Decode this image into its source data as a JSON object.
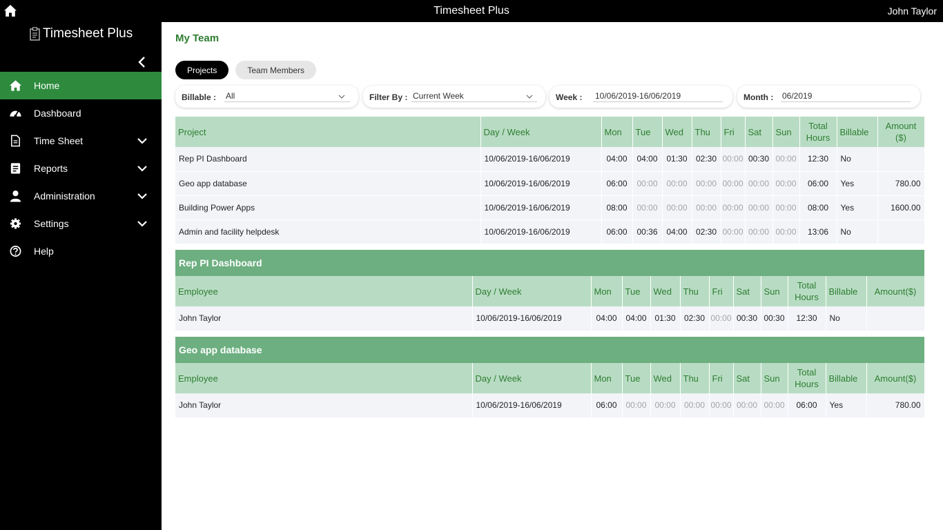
{
  "topbar": {
    "title": "Timesheet Plus",
    "user": "John Taylor"
  },
  "sidebar": {
    "brand": "Timesheet Plus",
    "items": [
      {
        "label": "Home",
        "icon": "home-icon",
        "active": true,
        "expandable": false
      },
      {
        "label": "Dashboard",
        "icon": "dashboard-gauge-icon",
        "active": false,
        "expandable": false
      },
      {
        "label": "Time Sheet",
        "icon": "document-icon",
        "active": false,
        "expandable": true
      },
      {
        "label": "Reports",
        "icon": "report-icon",
        "active": false,
        "expandable": true
      },
      {
        "label": "Administration",
        "icon": "user-icon",
        "active": false,
        "expandable": true
      },
      {
        "label": "Settings",
        "icon": "gear-icon",
        "active": false,
        "expandable": true
      },
      {
        "label": "Help",
        "icon": "help-icon",
        "active": false,
        "expandable": false
      }
    ]
  },
  "main": {
    "title": "My Team",
    "tabs": [
      {
        "label": "Projects",
        "selected": true
      },
      {
        "label": "Team Members",
        "selected": false
      }
    ],
    "filters": {
      "billable": {
        "label": "Billable :",
        "value": "All"
      },
      "filter_by": {
        "label": "Filter By :",
        "value": "Current Week"
      },
      "week": {
        "label": "Week :",
        "value": "10/06/2019-16/06/2019"
      },
      "month": {
        "label": "Month :",
        "value": "06/2019"
      }
    },
    "projects_table": {
      "headers": [
        "Project",
        "Day / Week",
        "Mon",
        "Tue",
        "Wed",
        "Thu",
        "Fri",
        "Sat",
        "Sun",
        "Total Hours",
        "Billable",
        "Amount ($)"
      ],
      "rows": [
        [
          "Rep PI Dashboard",
          "10/06/2019-16/06/2019",
          "04:00",
          "04:00",
          "01:30",
          "02:30",
          "00:00",
          "00:30",
          "00:00",
          "12:30",
          "No",
          ""
        ],
        [
          "Geo app database",
          "10/06/2019-16/06/2019",
          "06:00",
          "00:00",
          "00:00",
          "00:00",
          "00:00",
          "00:00",
          "00:00",
          "06:00",
          "Yes",
          "780.00"
        ],
        [
          "Building Power Apps",
          "10/06/2019-16/06/2019",
          "08:00",
          "00:00",
          "00:00",
          "00:00",
          "00:00",
          "00:00",
          "00:00",
          "08:00",
          "Yes",
          "1600.00"
        ],
        [
          "Admin and facility helpdesk",
          "10/06/2019-16/06/2019",
          "06:00",
          "00:36",
          "04:00",
          "02:30",
          "00:00",
          "00:00",
          "00:00",
          "13:06",
          "No",
          ""
        ]
      ]
    },
    "detail_sections": [
      {
        "title": "Rep PI Dashboard",
        "headers": [
          "Employee",
          "Day / Week",
          "Mon",
          "Tue",
          "Wed",
          "Thu",
          "Fri",
          "Sat",
          "Sun",
          "Total Hours",
          "Billable",
          "Amount($)"
        ],
        "rows": [
          [
            "John Taylor",
            "10/06/2019-16/06/2019",
            "04:00",
            "04:00",
            "01:30",
            "02:30",
            "00:00",
            "00:30",
            "00:30",
            "12:30",
            "No",
            ""
          ]
        ]
      },
      {
        "title": "Geo app database",
        "headers": [
          "Employee",
          "Day / Week",
          "Mon",
          "Tue",
          "Wed",
          "Thu",
          "Fri",
          "Sat",
          "Sun",
          "Total Hours",
          "Billable",
          "Amount($)"
        ],
        "rows": [
          [
            "John Taylor",
            "10/06/2019-16/06/2019",
            "06:00",
            "00:00",
            "00:00",
            "00:00",
            "00:00",
            "00:00",
            "00:00",
            "06:00",
            "Yes",
            "780.00"
          ]
        ]
      }
    ]
  },
  "colors": {
    "active_nav": "#2e8b3e",
    "header_green": "#b8dcc3",
    "section_green": "#6daf80",
    "title_green": "#2e7d32"
  }
}
